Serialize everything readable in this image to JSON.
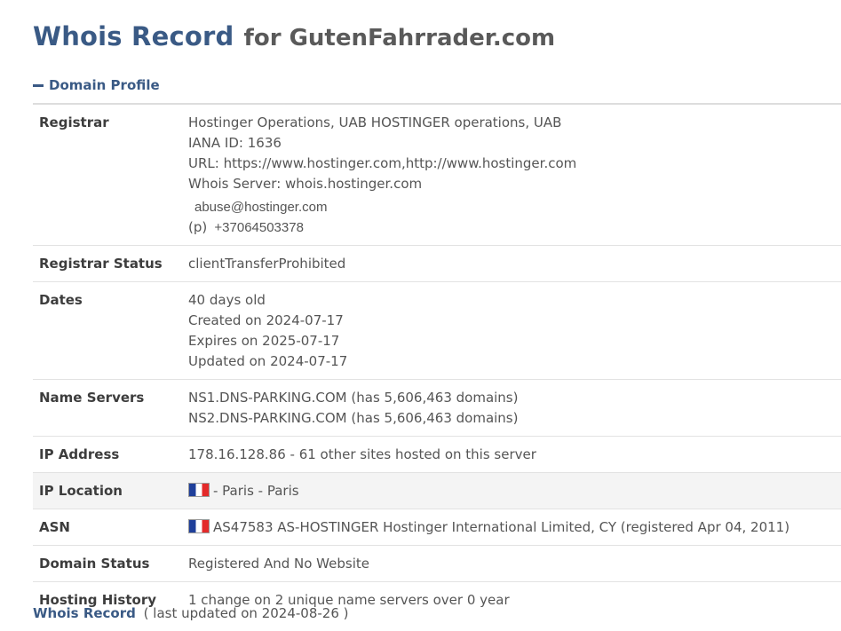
{
  "header": {
    "title": "Whois Record",
    "for_text": "for GutenFahrrader.com"
  },
  "section": {
    "label": "Domain Profile",
    "icon": "minus-icon"
  },
  "rows": {
    "registrar": {
      "label": "Registrar",
      "name": "Hostinger Operations, UAB HOSTINGER operations, UAB",
      "iana": "IANA ID: 1636",
      "url": "URL: https://www.hostinger.com,http://www.hostinger.com",
      "whois_server": "Whois Server: whois.hostinger.com",
      "email": "abuse@hostinger.com",
      "phone_prefix": "(p)",
      "phone": "+37064503378"
    },
    "registrar_status": {
      "label": "Registrar Status",
      "value": "clientTransferProhibited"
    },
    "dates": {
      "label": "Dates",
      "age": "40 days old",
      "created": "Created on 2024-07-17",
      "expires": "Expires on 2025-07-17",
      "updated": "Updated on 2024-07-17"
    },
    "name_servers": {
      "label": "Name Servers",
      "ns1": "NS1.DNS-PARKING.COM (has 5,606,463 domains)",
      "ns2": "NS2.DNS-PARKING.COM (has 5,606,463 domains)"
    },
    "ip_address": {
      "label": "IP Address",
      "value": "178.16.128.86 - 61 other sites hosted on this server"
    },
    "ip_location": {
      "label": "IP Location",
      "value": "- Paris - Paris",
      "flag": "france-flag-icon"
    },
    "asn": {
      "label": "ASN",
      "value": "AS47583 AS-HOSTINGER Hostinger International Limited, CY (registered Apr 04, 2011)",
      "flag": "france-flag-icon"
    },
    "domain_status": {
      "label": "Domain Status",
      "value": "Registered And No Website"
    },
    "hosting_history": {
      "label": "Hosting History",
      "value": "1 change on 2 unique name servers over 0 year"
    }
  },
  "footer": {
    "link_text": "Whois Record",
    "meta": "( last updated on 2024-08-26 )"
  },
  "colors": {
    "accent": "#3a5a85",
    "text": "#555555",
    "highlight_row": "#f4f4f4"
  }
}
